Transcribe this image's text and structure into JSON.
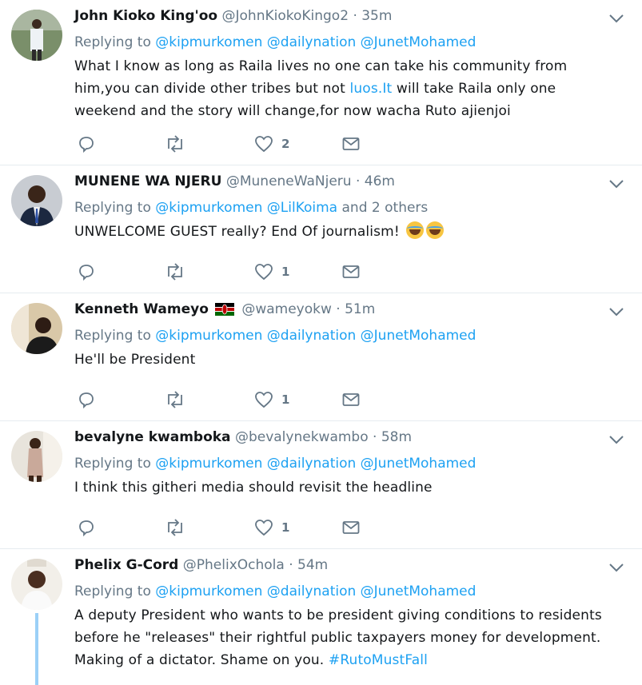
{
  "colors": {
    "link": "#1da1f2",
    "muted": "#657786",
    "border": "#e6ecf0"
  },
  "tweets": [
    {
      "name": "John Kioko King'oo",
      "handle": "@JohnKiokoKingo2",
      "time": "· 35m",
      "replying": "Replying to",
      "mentions": [
        "@kipmurkomen",
        "@dailynation",
        "@JunetMohamed"
      ],
      "text_a": "What I know as long as Raila lives no one can take his community from him,you can divide other tribes but not ",
      "text_link": "luos.It",
      "text_b": " will take Raila only one weekend and the story will change,for now wacha Ruto ajienjoi",
      "likes": "2"
    },
    {
      "name": "MUNENE WA NJERU",
      "handle": "@MuneneWaNjeru",
      "time": "· 46m",
      "replying": "Replying to",
      "mentions": [
        "@kipmurkomen",
        "@LilKoima"
      ],
      "others": "and 2 others",
      "text": "UNWELCOME GUEST really? End Of journalism!",
      "likes": "1"
    },
    {
      "name": "Kenneth Wameyo",
      "handle": "@wameyokw",
      "time": "· 51m",
      "replying": "Replying to",
      "mentions": [
        "@kipmurkomen",
        "@dailynation",
        "@JunetMohamed"
      ],
      "text": "He'll be President",
      "likes": "1"
    },
    {
      "name": "bevalyne kwamboka",
      "handle": "@bevalynekwambo",
      "time": "· 58m",
      "replying": "Replying to",
      "mentions": [
        "@kipmurkomen",
        "@dailynation",
        "@JunetMohamed"
      ],
      "text": "I think this githeri media should revisit the headline",
      "likes": "1"
    },
    {
      "name": "Phelix G-Cord",
      "handle": "@PhelixOchola",
      "time": "· 54m",
      "replying": "Replying to",
      "mentions": [
        "@kipmurkomen",
        "@dailynation",
        "@JunetMohamed"
      ],
      "text_a": "A deputy President who wants to be president giving conditions to residents before he \"releases\" their rightful public taxpayers money for development. Making of a dictator.  Shame on you. ",
      "hashtag": "#RutoMustFall"
    }
  ]
}
